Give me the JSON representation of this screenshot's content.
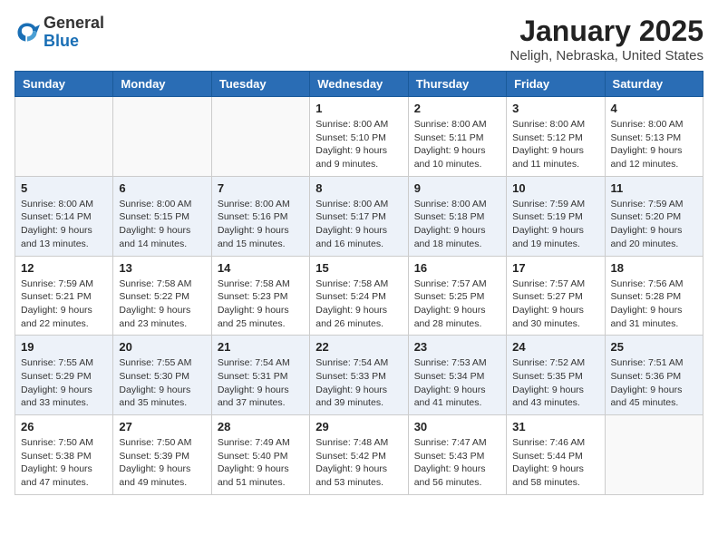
{
  "header": {
    "logo_general": "General",
    "logo_blue": "Blue",
    "month_title": "January 2025",
    "location": "Neligh, Nebraska, United States"
  },
  "days_of_week": [
    "Sunday",
    "Monday",
    "Tuesday",
    "Wednesday",
    "Thursday",
    "Friday",
    "Saturday"
  ],
  "weeks": [
    [
      {
        "day": "",
        "info": ""
      },
      {
        "day": "",
        "info": ""
      },
      {
        "day": "",
        "info": ""
      },
      {
        "day": "1",
        "info": "Sunrise: 8:00 AM\nSunset: 5:10 PM\nDaylight: 9 hours\nand 9 minutes."
      },
      {
        "day": "2",
        "info": "Sunrise: 8:00 AM\nSunset: 5:11 PM\nDaylight: 9 hours\nand 10 minutes."
      },
      {
        "day": "3",
        "info": "Sunrise: 8:00 AM\nSunset: 5:12 PM\nDaylight: 9 hours\nand 11 minutes."
      },
      {
        "day": "4",
        "info": "Sunrise: 8:00 AM\nSunset: 5:13 PM\nDaylight: 9 hours\nand 12 minutes."
      }
    ],
    [
      {
        "day": "5",
        "info": "Sunrise: 8:00 AM\nSunset: 5:14 PM\nDaylight: 9 hours\nand 13 minutes."
      },
      {
        "day": "6",
        "info": "Sunrise: 8:00 AM\nSunset: 5:15 PM\nDaylight: 9 hours\nand 14 minutes."
      },
      {
        "day": "7",
        "info": "Sunrise: 8:00 AM\nSunset: 5:16 PM\nDaylight: 9 hours\nand 15 minutes."
      },
      {
        "day": "8",
        "info": "Sunrise: 8:00 AM\nSunset: 5:17 PM\nDaylight: 9 hours\nand 16 minutes."
      },
      {
        "day": "9",
        "info": "Sunrise: 8:00 AM\nSunset: 5:18 PM\nDaylight: 9 hours\nand 18 minutes."
      },
      {
        "day": "10",
        "info": "Sunrise: 7:59 AM\nSunset: 5:19 PM\nDaylight: 9 hours\nand 19 minutes."
      },
      {
        "day": "11",
        "info": "Sunrise: 7:59 AM\nSunset: 5:20 PM\nDaylight: 9 hours\nand 20 minutes."
      }
    ],
    [
      {
        "day": "12",
        "info": "Sunrise: 7:59 AM\nSunset: 5:21 PM\nDaylight: 9 hours\nand 22 minutes."
      },
      {
        "day": "13",
        "info": "Sunrise: 7:58 AM\nSunset: 5:22 PM\nDaylight: 9 hours\nand 23 minutes."
      },
      {
        "day": "14",
        "info": "Sunrise: 7:58 AM\nSunset: 5:23 PM\nDaylight: 9 hours\nand 25 minutes."
      },
      {
        "day": "15",
        "info": "Sunrise: 7:58 AM\nSunset: 5:24 PM\nDaylight: 9 hours\nand 26 minutes."
      },
      {
        "day": "16",
        "info": "Sunrise: 7:57 AM\nSunset: 5:25 PM\nDaylight: 9 hours\nand 28 minutes."
      },
      {
        "day": "17",
        "info": "Sunrise: 7:57 AM\nSunset: 5:27 PM\nDaylight: 9 hours\nand 30 minutes."
      },
      {
        "day": "18",
        "info": "Sunrise: 7:56 AM\nSunset: 5:28 PM\nDaylight: 9 hours\nand 31 minutes."
      }
    ],
    [
      {
        "day": "19",
        "info": "Sunrise: 7:55 AM\nSunset: 5:29 PM\nDaylight: 9 hours\nand 33 minutes."
      },
      {
        "day": "20",
        "info": "Sunrise: 7:55 AM\nSunset: 5:30 PM\nDaylight: 9 hours\nand 35 minutes."
      },
      {
        "day": "21",
        "info": "Sunrise: 7:54 AM\nSunset: 5:31 PM\nDaylight: 9 hours\nand 37 minutes."
      },
      {
        "day": "22",
        "info": "Sunrise: 7:54 AM\nSunset: 5:33 PM\nDaylight: 9 hours\nand 39 minutes."
      },
      {
        "day": "23",
        "info": "Sunrise: 7:53 AM\nSunset: 5:34 PM\nDaylight: 9 hours\nand 41 minutes."
      },
      {
        "day": "24",
        "info": "Sunrise: 7:52 AM\nSunset: 5:35 PM\nDaylight: 9 hours\nand 43 minutes."
      },
      {
        "day": "25",
        "info": "Sunrise: 7:51 AM\nSunset: 5:36 PM\nDaylight: 9 hours\nand 45 minutes."
      }
    ],
    [
      {
        "day": "26",
        "info": "Sunrise: 7:50 AM\nSunset: 5:38 PM\nDaylight: 9 hours\nand 47 minutes."
      },
      {
        "day": "27",
        "info": "Sunrise: 7:50 AM\nSunset: 5:39 PM\nDaylight: 9 hours\nand 49 minutes."
      },
      {
        "day": "28",
        "info": "Sunrise: 7:49 AM\nSunset: 5:40 PM\nDaylight: 9 hours\nand 51 minutes."
      },
      {
        "day": "29",
        "info": "Sunrise: 7:48 AM\nSunset: 5:42 PM\nDaylight: 9 hours\nand 53 minutes."
      },
      {
        "day": "30",
        "info": "Sunrise: 7:47 AM\nSunset: 5:43 PM\nDaylight: 9 hours\nand 56 minutes."
      },
      {
        "day": "31",
        "info": "Sunrise: 7:46 AM\nSunset: 5:44 PM\nDaylight: 9 hours\nand 58 minutes."
      },
      {
        "day": "",
        "info": ""
      }
    ]
  ]
}
